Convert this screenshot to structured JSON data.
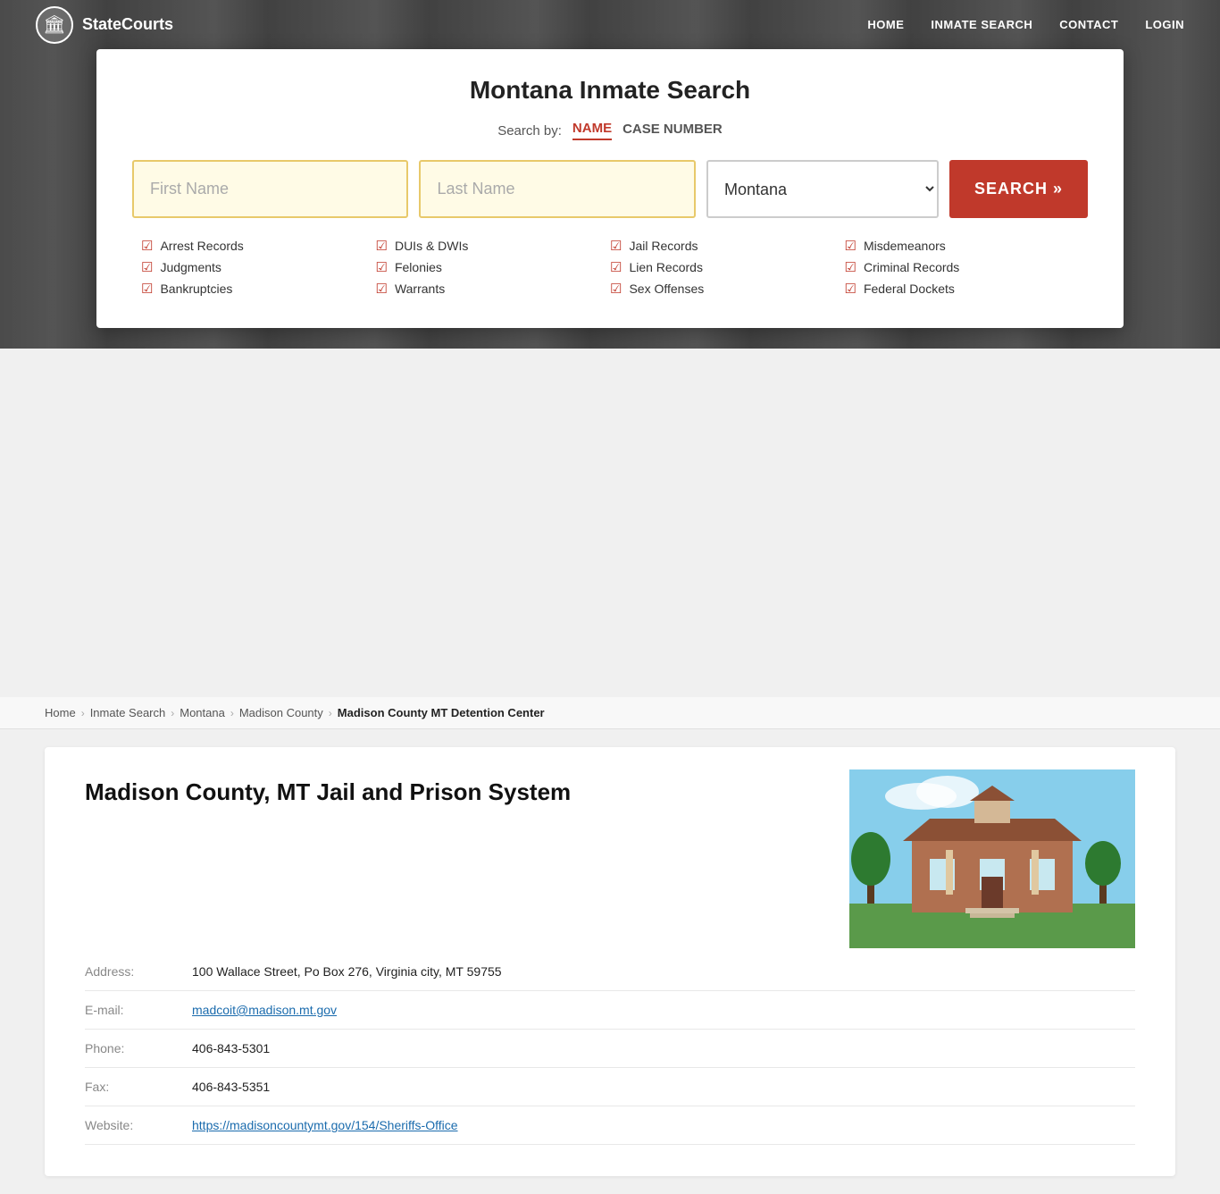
{
  "site": {
    "name": "StateCourts",
    "logo_alt": "column-icon"
  },
  "nav": {
    "links": [
      {
        "label": "HOME",
        "href": "#"
      },
      {
        "label": "INMATE SEARCH",
        "href": "#"
      },
      {
        "label": "CONTACT",
        "href": "#"
      },
      {
        "label": "LOGIN",
        "href": "#"
      }
    ]
  },
  "modal": {
    "title": "Montana Inmate Search",
    "search_by_label": "Search by:",
    "tabs": [
      {
        "label": "NAME",
        "active": true
      },
      {
        "label": "CASE NUMBER",
        "active": false
      }
    ],
    "first_name_placeholder": "First Name",
    "last_name_placeholder": "Last Name",
    "state_value": "Montana",
    "search_button_label": "SEARCH »",
    "features": [
      "Arrest Records",
      "DUIs & DWIs",
      "Jail Records",
      "Misdemeanors",
      "Judgments",
      "Felonies",
      "Lien Records",
      "Criminal Records",
      "Bankruptcies",
      "Warrants",
      "Sex Offenses",
      "Federal Dockets"
    ]
  },
  "breadcrumb": {
    "items": [
      {
        "label": "Home",
        "href": "#"
      },
      {
        "label": "Inmate Search",
        "href": "#"
      },
      {
        "label": "Montana",
        "href": "#"
      },
      {
        "label": "Madison County",
        "href": "#"
      },
      {
        "label": "Madison County MT Detention Center",
        "current": true
      }
    ]
  },
  "facility": {
    "title": "Madison County, MT Jail and Prison System",
    "address_label": "Address:",
    "address_value": "100 Wallace Street, Po Box 276, Virginia city, MT 59755",
    "email_label": "E-mail:",
    "email_value": "madcoit@madison.mt.gov",
    "phone_label": "Phone:",
    "phone_value": "406-843-5301",
    "fax_label": "Fax:",
    "fax_value": "406-843-5351",
    "website_label": "Website:",
    "website_value": "https://madisoncountymt.gov/154/Sheriffs-Office"
  }
}
